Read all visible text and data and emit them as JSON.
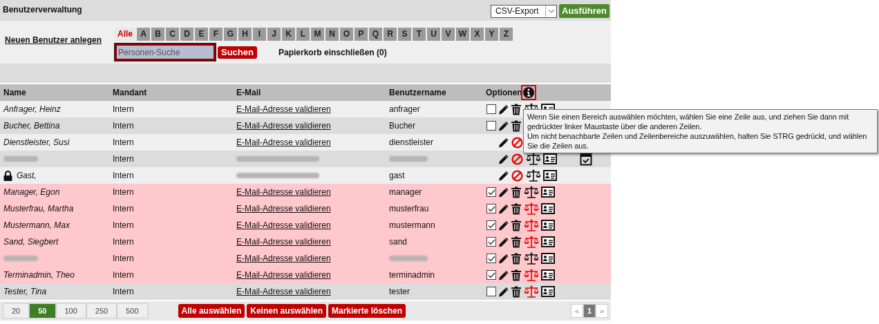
{
  "header": {
    "title": "Benutzerverwaltung",
    "export_select": {
      "value": "CSV-Export"
    },
    "run_button": "Ausführen"
  },
  "new_user_link": "Neuen Benutzer anlegen",
  "letters": [
    {
      "label": "Alle",
      "selected": true
    },
    {
      "label": "A",
      "selected": false
    },
    {
      "label": "B",
      "selected": false
    },
    {
      "label": "C",
      "selected": false
    },
    {
      "label": "D",
      "selected": false
    },
    {
      "label": "E",
      "selected": false
    },
    {
      "label": "F",
      "selected": false
    },
    {
      "label": "G",
      "selected": false
    },
    {
      "label": "H",
      "selected": false
    },
    {
      "label": "I",
      "selected": false
    },
    {
      "label": "J",
      "selected": false
    },
    {
      "label": "K",
      "selected": false
    },
    {
      "label": "L",
      "selected": false
    },
    {
      "label": "M",
      "selected": false
    },
    {
      "label": "N",
      "selected": false
    },
    {
      "label": "O",
      "selected": false
    },
    {
      "label": "P",
      "selected": false
    },
    {
      "label": "Q",
      "selected": false
    },
    {
      "label": "R",
      "selected": false
    },
    {
      "label": "S",
      "selected": false
    },
    {
      "label": "T",
      "selected": false
    },
    {
      "label": "U",
      "selected": false
    },
    {
      "label": "V",
      "selected": false
    },
    {
      "label": "W",
      "selected": false
    },
    {
      "label": "X",
      "selected": false
    },
    {
      "label": "Y",
      "selected": false
    },
    {
      "label": "Z",
      "selected": false
    }
  ],
  "search": {
    "placeholder": "Personen-Suche",
    "button": "Suchen"
  },
  "trash_toggle": "Papierkorb einschließen (0)",
  "table": {
    "columns": [
      "Name",
      "Mandant",
      "E-Mail",
      "Benutzername",
      "Optionen"
    ],
    "rows": [
      {
        "name": "Anfrager, Heinz",
        "client": "Intern",
        "email": "E-Mail-Adresse validieren",
        "username": "anfrager",
        "selected": false,
        "has_checkbox": true,
        "checked": false,
        "deletable": true,
        "scale_red": false
      },
      {
        "name": "Bucher, Bettina",
        "client": "Intern",
        "email": "E-Mail-Adresse validieren",
        "username": "Bucher",
        "selected": false,
        "has_checkbox": true,
        "checked": false,
        "deletable": true
      },
      {
        "name": "Dienstleister, Susi",
        "client": "Intern",
        "email": "E-Mail-Adresse validieren",
        "username": "dienstleister",
        "selected": false,
        "has_checkbox": false,
        "deletable": false
      },
      {
        "name_redacted": true,
        "client": "Intern",
        "email_redacted": true,
        "username_redacted": true,
        "selected": false,
        "has_checkbox": false,
        "deletable": false,
        "scale_red": false,
        "calendar": true
      },
      {
        "name": "Gast,",
        "locked": true,
        "client": "Intern",
        "email_redacted": true,
        "username": "gast",
        "selected": false,
        "has_checkbox": false,
        "deletable": false,
        "scale_red": false
      },
      {
        "name": "Manager, Egon",
        "client": "Intern",
        "email": "E-Mail-Adresse validieren",
        "username": "manager",
        "selected": true,
        "has_checkbox": true,
        "checked": true,
        "deletable": true,
        "scale_red": false
      },
      {
        "name": "Musterfrau, Martha",
        "client": "Intern",
        "email": "E-Mail-Adresse validieren",
        "username": "musterfrau",
        "selected": true,
        "has_checkbox": true,
        "checked": true,
        "deletable": true,
        "scale_red": true
      },
      {
        "name": "Mustermann, Max",
        "client": "Intern",
        "email": "E-Mail-Adresse validieren",
        "username": "mustermann",
        "selected": true,
        "has_checkbox": true,
        "checked": true,
        "deletable": true,
        "scale_red": true
      },
      {
        "name": "Sand, Siegbert",
        "client": "Intern",
        "email": "E-Mail-Adresse validieren",
        "username": "sand",
        "selected": true,
        "has_checkbox": true,
        "checked": true,
        "deletable": true,
        "scale_red": true
      },
      {
        "name_redacted": true,
        "client": "Intern",
        "email": "E-Mail-Adresse validieren",
        "username_redacted": true,
        "selected": true,
        "has_checkbox": true,
        "checked": true,
        "deletable": true,
        "scale_red": false
      },
      {
        "name": "Terminadmin, Theo",
        "client": "Intern",
        "email": "E-Mail-Adresse validieren",
        "username": "terminadmin",
        "selected": true,
        "has_checkbox": true,
        "checked": true,
        "deletable": true,
        "scale_red": true
      },
      {
        "name": "Tester, Tina",
        "client": "Intern",
        "email": "E-Mail-Adresse validieren",
        "username": "tester",
        "selected": false,
        "has_checkbox": true,
        "checked": false,
        "deletable": true,
        "scale_red": true
      }
    ]
  },
  "tooltip": {
    "lines": [
      "Wenn Sie einen Bereich auswählen möchten, wählen Sie eine Zeile aus, und ziehen Sie dann mit gedrückter linker Maustaste über die anderen Zeilen.",
      "Um nicht benachbarte Zeilen und Zeilenbereiche auszuwählen, halten Sie STRG gedrückt, und wählen Sie die Zeilen aus."
    ]
  },
  "page_sizes": [
    {
      "label": "20",
      "selected": false
    },
    {
      "label": "50",
      "selected": true
    },
    {
      "label": "100",
      "selected": false
    },
    {
      "label": "250",
      "selected": false
    },
    {
      "label": "500",
      "selected": false
    }
  ],
  "actions": [
    "Alle auswählen",
    "Keinen auswählen",
    "Markierte löschen"
  ],
  "pagination": [
    {
      "label": "«",
      "selected": false
    },
    {
      "label": "1",
      "selected": true
    },
    {
      "label": "»",
      "selected": false
    }
  ]
}
